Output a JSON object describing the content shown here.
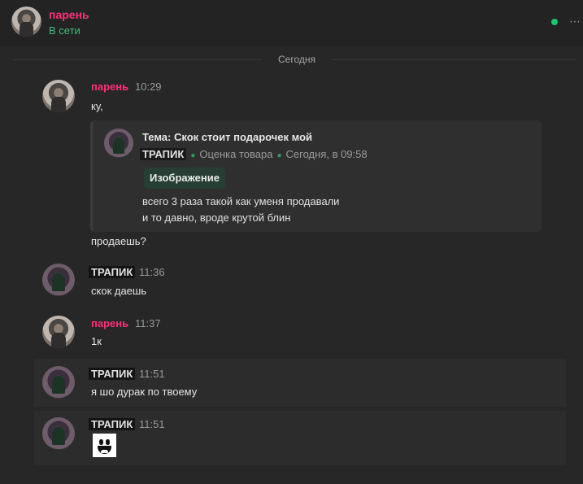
{
  "header": {
    "name": "парень",
    "status": "В сети",
    "more": "⋯"
  },
  "date_separator": "Сегодня",
  "messages": [
    {
      "author": "парень",
      "time": "10:29",
      "text": "ку,",
      "quote": {
        "title": "Тема: Скок стоит подарочек мой",
        "author": "ТРАПИК",
        "section": "Оценка товара",
        "date": "Сегодня, в 09:58",
        "attachment": "Изображение",
        "lines": [
          "всего 3 раза такой как уменя продавали",
          "и то давно, вроде крутой блин"
        ]
      },
      "text2": "продаешь?"
    },
    {
      "author": "ТРАПИК",
      "time": "11:36",
      "text": "скок даешь"
    },
    {
      "author": "парень",
      "time": "11:37",
      "text": "1к"
    },
    {
      "author": "ТРАПИК",
      "time": "11:51",
      "text": "я шо дурак по твоему"
    },
    {
      "author": "ТРАПИК",
      "time": "11:51",
      "sticker": "grinning-face-sticker"
    }
  ],
  "colors": {
    "background": "#272727",
    "accent_pink": "#ff2f7a",
    "online_green": "#22c36e",
    "attachment_chip": "#263e33"
  }
}
